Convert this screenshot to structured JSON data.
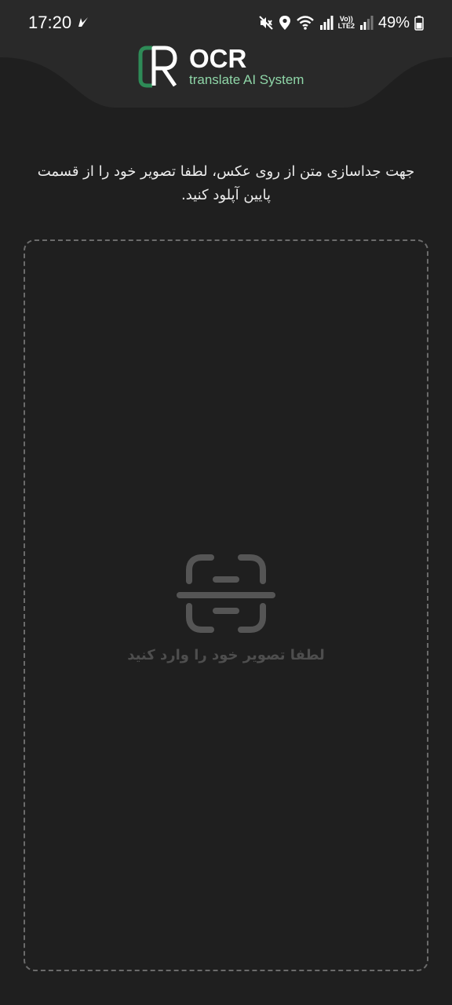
{
  "status_bar": {
    "time": "17:20",
    "lte_top": "Vo))",
    "lte_bottom": "LTE2",
    "battery_percent": "49%",
    "icons": [
      "navigation-arrow-icon",
      "mute-icon",
      "location-icon",
      "wifi-icon",
      "signal-icon",
      "battery-icon"
    ]
  },
  "header": {
    "logo_title": "OCR",
    "logo_subtitle": "translate AI System",
    "accent_color": "#2e8b57"
  },
  "main": {
    "instruction_text": "جهت جداسازی متن از روی عکس، لطفا تصویر خود را از قسمت پایین آپلود کنید.",
    "upload_label": "لطفا تصویر خود را وارد کنید",
    "upload_icon": "scan-document-icon"
  }
}
